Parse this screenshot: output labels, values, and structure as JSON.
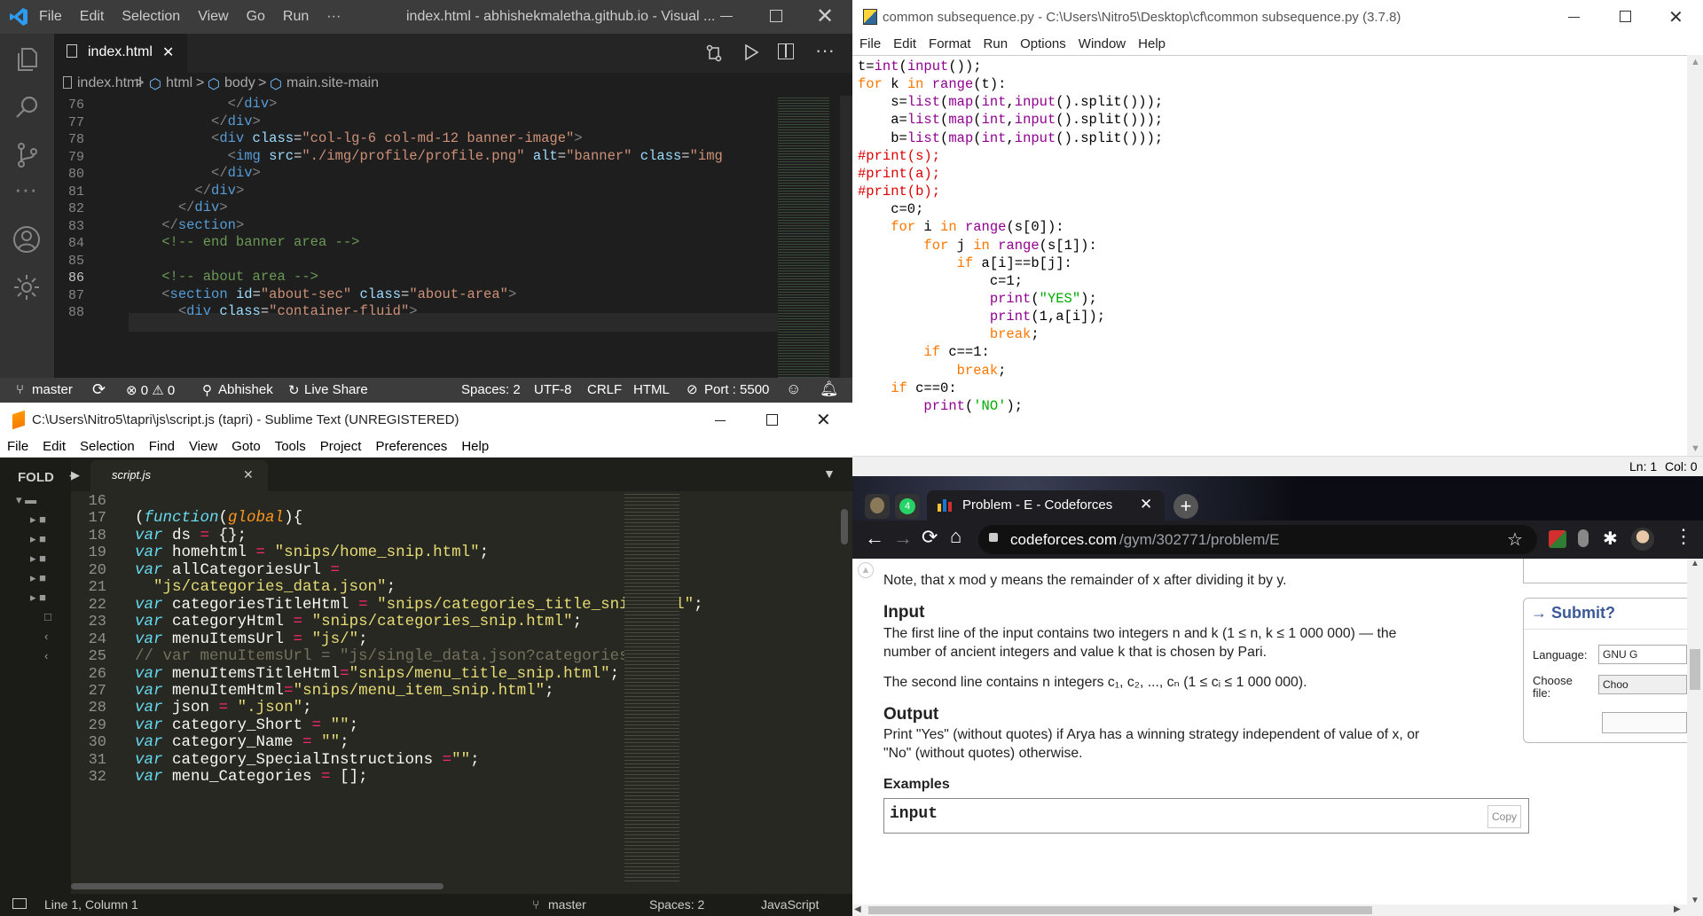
{
  "vscode": {
    "menu": [
      "File",
      "Edit",
      "Selection",
      "View",
      "Go",
      "Run",
      "···"
    ],
    "title": "index.html - abhishekmaletha.github.io - Visual ...",
    "tab_label": "index.html",
    "breadcrumb": [
      "index.html",
      "html",
      "body",
      "main.site-main"
    ],
    "line_numbers": [
      "76",
      "77",
      "78",
      "79",
      "80",
      "81",
      "82",
      "83",
      "84",
      "85",
      "86",
      "87",
      "88"
    ],
    "status": {
      "branch": "master",
      "problems": "⊗ 0 ⚠ 0",
      "user": "Abhishek",
      "live_share": "Live Share",
      "spaces": "Spaces: 2",
      "encoding": "UTF-8",
      "eol": "CRLF",
      "language": "HTML",
      "port": "Port : 5500"
    }
  },
  "sublime": {
    "title": "C:\\Users\\Nitro5\\tapri\\js\\script.js (tapri) - Sublime Text (UNREGISTERED)",
    "menu": [
      "File",
      "Edit",
      "Selection",
      "Find",
      "View",
      "Goto",
      "Tools",
      "Project",
      "Preferences",
      "Help"
    ],
    "folders_label": "FOLD",
    "tab_label": "script.js",
    "line_numbers": [
      "16",
      "17",
      "18",
      "19",
      "20",
      "21",
      "22",
      "23",
      "24",
      "25",
      "26",
      "27",
      "28",
      "29",
      "30",
      "31",
      "32"
    ],
    "status": {
      "position": "Line 1, Column 1",
      "branch": "master",
      "spaces": "Spaces: 2",
      "syntax": "JavaScript"
    }
  },
  "idle": {
    "title": "common subsequence.py - C:\\Users\\Nitro5\\Desktop\\cf\\common subsequence.py (3.7.8)",
    "menu": [
      "File",
      "Edit",
      "Format",
      "Run",
      "Options",
      "Window",
      "Help"
    ],
    "status_ln": "Ln: 1",
    "status_col": "Col: 0"
  },
  "chrome": {
    "tab_title": "Problem - E - Codeforces",
    "url_domain": "codeforces.com",
    "url_path": "/gym/302771/problem/E",
    "note": "Note, that x mod y means the remainder of x after dividing it by y.",
    "input_heading": "Input",
    "input_p1": "The first line of the input contains two integers n and k (1 ≤ n,  k ≤ 1 000 000) — the number of ancient integers and value k that is chosen by Pari.",
    "input_p2": "The second line contains n integers c₁, c₂, ..., cₙ (1 ≤ cᵢ ≤ 1 000 000).",
    "output_heading": "Output",
    "output_p": "Print \"Yes\" (without quotes) if Arya has a winning strategy independent of value of x, or \"No\" (without quotes) otherwise.",
    "examples_heading": "Examples",
    "example_label": "input",
    "copy_label": "Copy",
    "submit_title": "→ Submit?",
    "language_label": "Language:",
    "language_value": "GNU G",
    "choose_label": "Choose file:",
    "choose_button": "Choo"
  }
}
